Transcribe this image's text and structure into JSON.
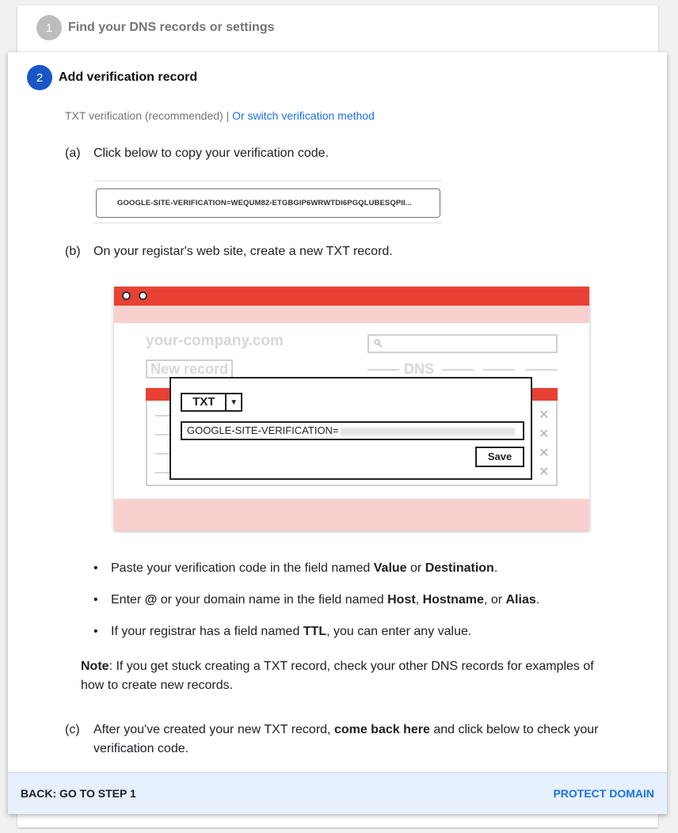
{
  "step1": {
    "number": "1",
    "title": "Find your DNS records or settings"
  },
  "step2": {
    "number": "2",
    "title": "Add verification record"
  },
  "method": {
    "label": "TXT verification (recommended)",
    "separator": " | ",
    "switch_link": "Or switch verification method"
  },
  "step_a": {
    "letter": "(a)",
    "text": "Click below to copy your verification code."
  },
  "verification_code": "GOOGLE-SITE-VERIFICATION=WEQUM82-ETGBGIP6WRWTDI6PGQLUBESQPII...",
  "step_b": {
    "letter": "(b)",
    "text": "On your registar's web site, create a new TXT record."
  },
  "illustration": {
    "domain": "your-company.com",
    "new_record": "New record",
    "dns": "DNS",
    "record_type": "TXT",
    "value_prefix": "GOOGLE-SITE-VERIFICATION=",
    "save": "Save",
    "colors": {
      "accent": "#e84134",
      "tint": "#f8d1cf"
    }
  },
  "bullets": [
    {
      "parts": [
        "Paste your verification code in the field named ",
        "Value",
        " or ",
        "Destination",
        "."
      ]
    },
    {
      "parts": [
        "Enter ",
        "@",
        " or your domain name in the field named ",
        "Host",
        ", ",
        "Hostname",
        ", or ",
        "Alias",
        "."
      ]
    },
    {
      "parts": [
        "If your registrar has a field named ",
        "TTL",
        ", you can enter any value."
      ]
    }
  ],
  "note": {
    "label": "Note",
    "text": ": If you get stuck creating a TXT record, check your other DNS records for examples of how to create new records."
  },
  "step_c": {
    "letter": "(c)",
    "pre": "After you've created your new TXT record, ",
    "bold": "come back here",
    "post": " and click below to check your verification code."
  },
  "footer": {
    "back": "BACK: GO TO STEP 1",
    "protect": "PROTECT DOMAIN"
  },
  "colors": {
    "step_active": "#1a55c8",
    "step_inactive": "#bdbdbd",
    "link": "#1a73e8",
    "footer_bg": "#e7f0fd"
  }
}
